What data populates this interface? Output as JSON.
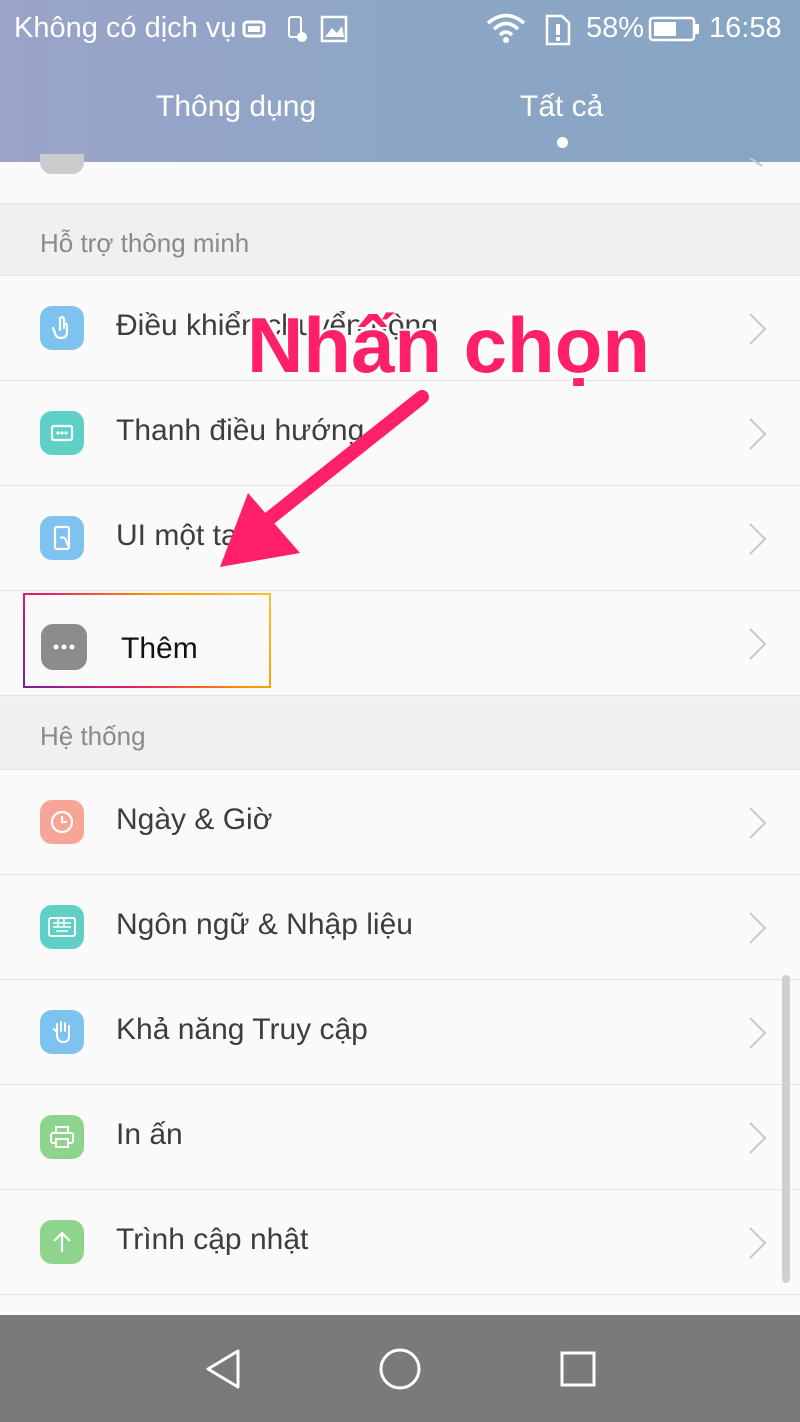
{
  "status_bar": {
    "carrier": "Không có dịch vụ",
    "battery": "58%",
    "time": "16:58",
    "icons": [
      "sim-icon",
      "notification-icon",
      "image-icon",
      "wifi-icon",
      "sim-alert-icon",
      "battery-icon"
    ]
  },
  "tabs": [
    {
      "label": "Thông dụng",
      "active": false
    },
    {
      "label": "Tất cả",
      "active": true
    }
  ],
  "sections": [
    {
      "title": "Hỗ trợ thông minh",
      "items": [
        {
          "label": "Điều khiển chuyển động",
          "icon": "gesture-icon",
          "color": "#7ec3f0"
        },
        {
          "label": "Thanh điều hướng",
          "icon": "navigation-bar-icon",
          "color": "#5ed0c6"
        },
        {
          "label": "UI một tay",
          "icon": "one-hand-icon",
          "color": "#7ec3f0"
        },
        {
          "label": "Thêm",
          "icon": "more-icon",
          "color": "#8c8c8c"
        }
      ]
    },
    {
      "title": "Hệ thống",
      "items": [
        {
          "label": "Ngày & Giờ",
          "icon": "clock-icon",
          "color": "#f6a596"
        },
        {
          "label": "Ngôn ngữ & Nhập liệu",
          "icon": "keyboard-icon",
          "color": "#5ed0c6"
        },
        {
          "label": "Khả năng Truy cập",
          "icon": "hand-icon",
          "color": "#7ec3f0"
        },
        {
          "label": "In ấn",
          "icon": "printer-icon",
          "color": "#8fd48c"
        },
        {
          "label": "Trình cập nhật",
          "icon": "update-icon",
          "color": "#8fd48c"
        }
      ]
    }
  ],
  "annotation": {
    "text": "Nhấn chọn",
    "color": "#ff1f6b"
  },
  "nav": [
    "back-icon",
    "home-icon",
    "recents-icon"
  ]
}
